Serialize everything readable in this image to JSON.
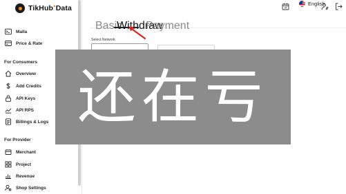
{
  "brand": {
    "name": "TikHub",
    "dot": "●",
    "suffix": "Data"
  },
  "sidebar": {
    "top_items": [
      {
        "label": "Malla",
        "icon": "terminal-icon"
      },
      {
        "label": "Price & Rate",
        "icon": "price-tag-icon"
      }
    ],
    "consumers": {
      "title": "For Consumers",
      "items": [
        {
          "label": "Overview",
          "icon": "home-icon"
        },
        {
          "label": "Add Credits",
          "icon": "dollar-icon"
        },
        {
          "label": "API Keys",
          "icon": "lock-icon"
        },
        {
          "label": "API RPS",
          "icon": "trend-icon"
        },
        {
          "label": "Billings & Logs",
          "icon": "document-icon"
        }
      ]
    },
    "provider": {
      "title": "For Provider",
      "items": [
        {
          "label": "Merchant",
          "icon": "merchant-icon"
        },
        {
          "label": "Project",
          "icon": "grid-icon"
        },
        {
          "label": "Revenue",
          "icon": "revenue-icon"
        },
        {
          "label": "Shop Settings",
          "icon": "user-settings-icon"
        }
      ]
    }
  },
  "topbar": {
    "language": "English",
    "icons": [
      "calendar-icon",
      "user-switch-icon",
      "logout-icon"
    ]
  },
  "tabs": [
    {
      "label": "Basic",
      "active": false
    },
    {
      "label": "Withdraw",
      "active": true
    },
    {
      "label": "Payment",
      "active": false
    }
  ],
  "form": {
    "network_label": "Select Network"
  },
  "overlay": {
    "text": "还在亏"
  },
  "colors": {
    "arrow": "#e02020",
    "overlay": "#8c8c8c",
    "brand_accent": "#f08a1c"
  }
}
